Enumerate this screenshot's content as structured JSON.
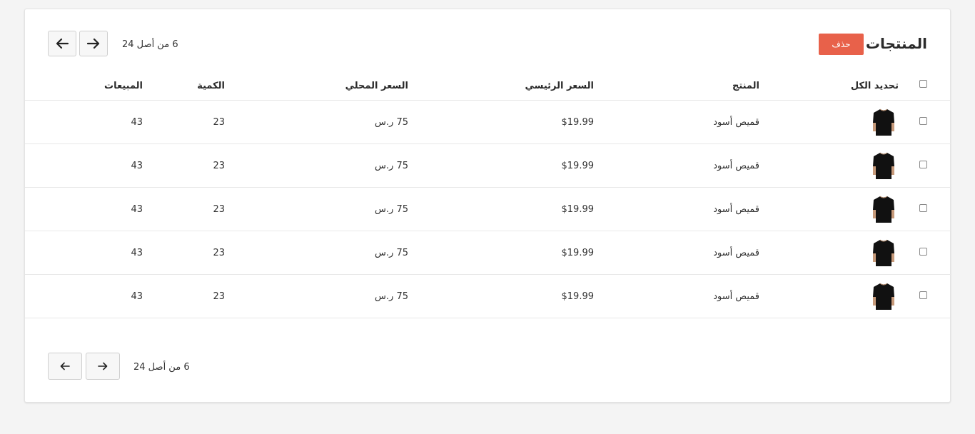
{
  "header": {
    "title": "المنتجات",
    "delete_label": "حذف",
    "pagination_label": "6 من أصل 24"
  },
  "table": {
    "columns": {
      "select_all": "تحديد الكل",
      "product": "المنتج",
      "main_price": "السعر الرئيسي",
      "local_price": "السعر المحلي",
      "quantity": "الكمية",
      "sales": "المبيعات"
    },
    "rows": [
      {
        "name": "قميص أسود",
        "main_price": "$19.99",
        "local_price": "75 ر.س",
        "quantity": "23",
        "sales": "43"
      },
      {
        "name": "قميص أسود",
        "main_price": "$19.99",
        "local_price": "75 ر.س",
        "quantity": "23",
        "sales": "43"
      },
      {
        "name": "قميص أسود",
        "main_price": "$19.99",
        "local_price": "75 ر.س",
        "quantity": "23",
        "sales": "43"
      },
      {
        "name": "قميص أسود",
        "main_price": "$19.99",
        "local_price": "75 ر.س",
        "quantity": "23",
        "sales": "43"
      },
      {
        "name": "قميص أسود",
        "main_price": "$19.99",
        "local_price": "75 ر.س",
        "quantity": "23",
        "sales": "43"
      }
    ]
  },
  "footer": {
    "pagination_label": "6 من أصل 24"
  },
  "colors": {
    "accent": "#e8614a",
    "background": "#f4f4f4"
  },
  "icons": {
    "next": "arrow-right-icon",
    "prev": "arrow-left-icon",
    "product": "black-tshirt-icon"
  }
}
